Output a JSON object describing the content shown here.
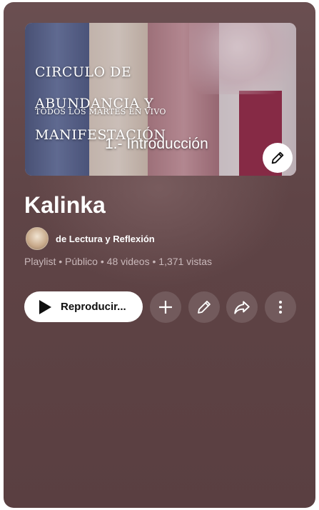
{
  "thumbnail": {
    "title_line1": "CIRCULO DE",
    "title_line2": "ABUNDANCIA Y",
    "title_line3": "MANIFESTACIÓN",
    "subtitle": "TODOS LOS MARTES EN VIVO",
    "video_label": "1.- Introducción",
    "edit_icon": "pencil-icon"
  },
  "playlist": {
    "title": "Kalinka",
    "channel": "de Lectura y Reflexión",
    "meta": {
      "type": "Playlist",
      "visibility": "Público",
      "videos": "48 videos",
      "views": "1,371 vistas"
    }
  },
  "actions": {
    "play_label": "Reproducir...",
    "play_icon": "play-icon",
    "add_icon": "plus-icon",
    "edit_icon": "pencil-icon",
    "share_icon": "share-icon",
    "more_icon": "more-vertical-icon"
  },
  "colors": {
    "card_bg": "#5f4446",
    "text_primary": "#ffffff",
    "text_secondary": "#c9b8ba"
  }
}
